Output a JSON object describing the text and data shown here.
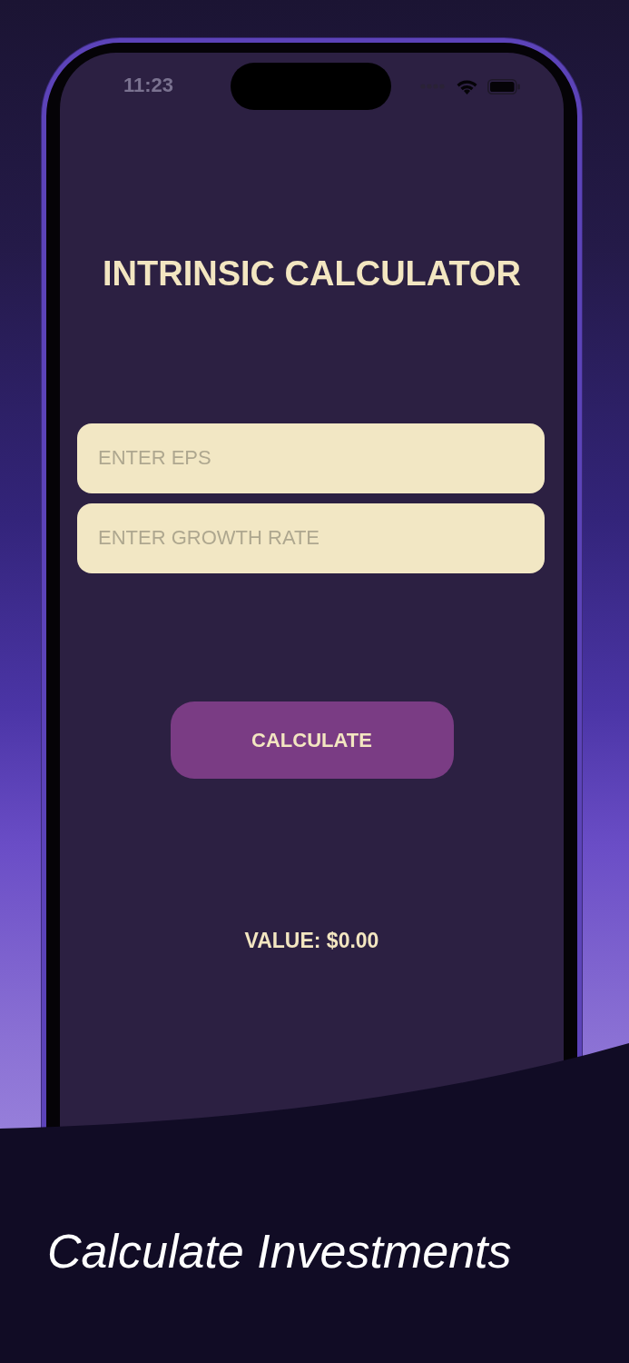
{
  "status_bar": {
    "time": "11:23"
  },
  "app": {
    "title": "INTRINSIC CALCULATOR",
    "fields": [
      {
        "placeholder": "ENTER EPS"
      },
      {
        "placeholder": "ENTER GROWTH RATE"
      }
    ],
    "button": "CALCULATE",
    "result": "VALUE: $0.00"
  },
  "caption": "Calculate Investments"
}
